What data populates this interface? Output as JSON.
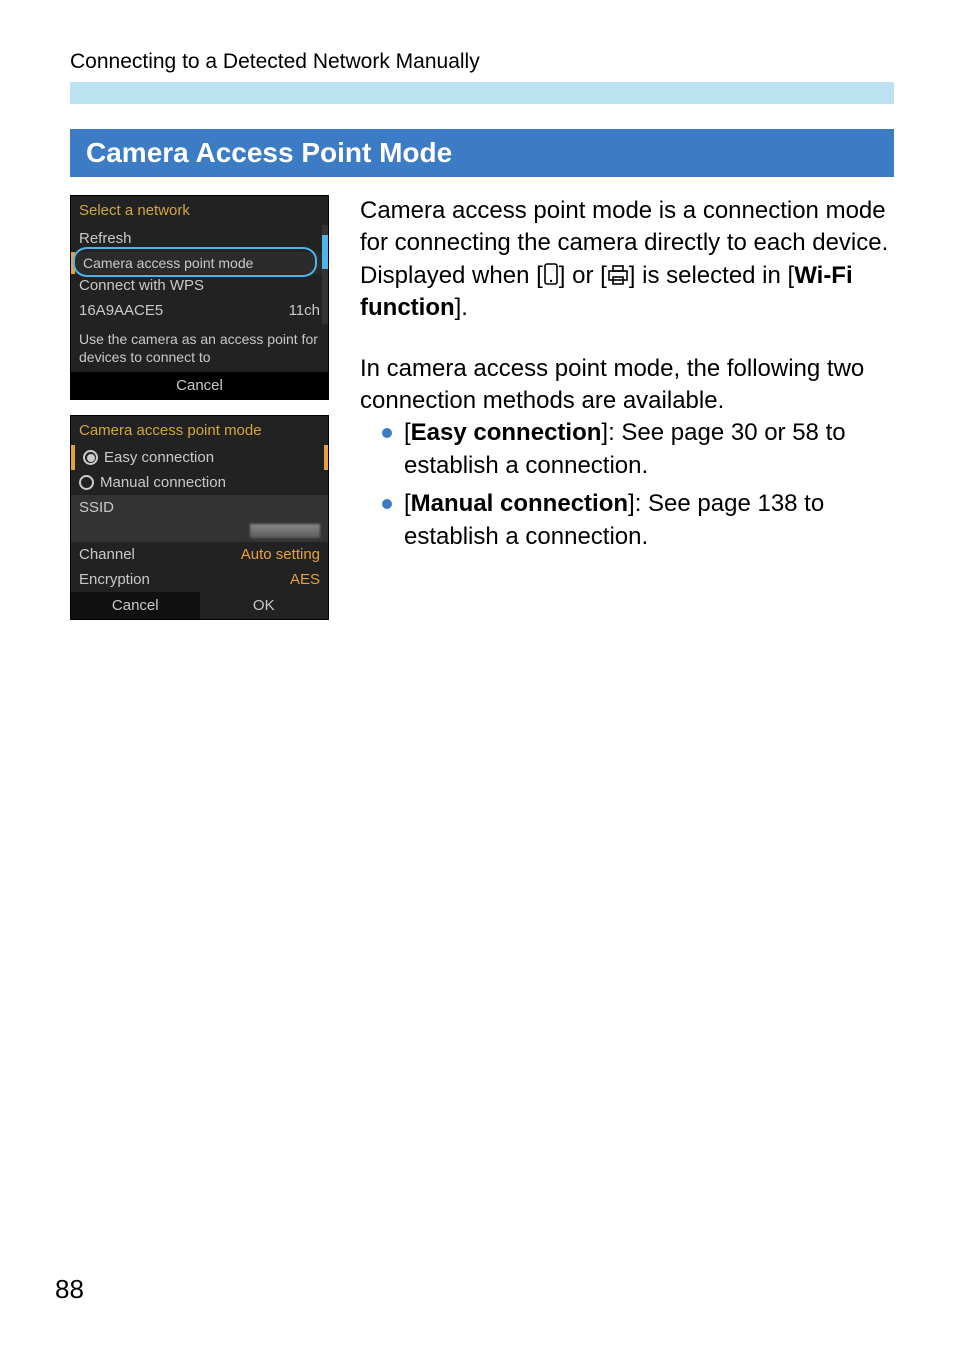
{
  "header": {
    "breadcrumb": "Connecting to a Detected Network Manually"
  },
  "section": {
    "title": "Camera Access Point Mode"
  },
  "body": {
    "para1_a": "Camera access point mode is a connection mode for connecting the camera directly to each device.",
    "para1_b_pre": "Displayed when [",
    "para1_b_mid": "] or [",
    "para1_b_post": "] is selected in [",
    "para1_b_bold": "Wi-Fi function",
    "para1_b_end": "].",
    "para2": "In camera access point mode, the following two connection methods are available.",
    "bullet1_pre": "[",
    "bullet1_bold": "Easy connection",
    "bullet1_post": "]: See page 30 or 58 to establish a connection.",
    "bullet2_pre": "[",
    "bullet2_bold": "Manual connection",
    "bullet2_post": "]: See page 138 to establish a connection."
  },
  "cam1": {
    "title": "Select a network",
    "refresh": "Refresh",
    "camera_ap": "Camera access point mode",
    "connect_wps": "Connect with WPS",
    "ssid": "16A9AACE5",
    "channel": "11ch",
    "hint": "Use the camera as an access point for devices to connect to",
    "cancel": "Cancel"
  },
  "cam2": {
    "title": "Camera access point mode",
    "easy": "Easy connection",
    "manual": "Manual connection",
    "ssid_label": "SSID",
    "channel_label": "Channel",
    "channel_value": "Auto setting",
    "enc_label": "Encryption",
    "enc_value": "AES",
    "cancel": "Cancel",
    "ok": "OK"
  },
  "page_number": "88"
}
